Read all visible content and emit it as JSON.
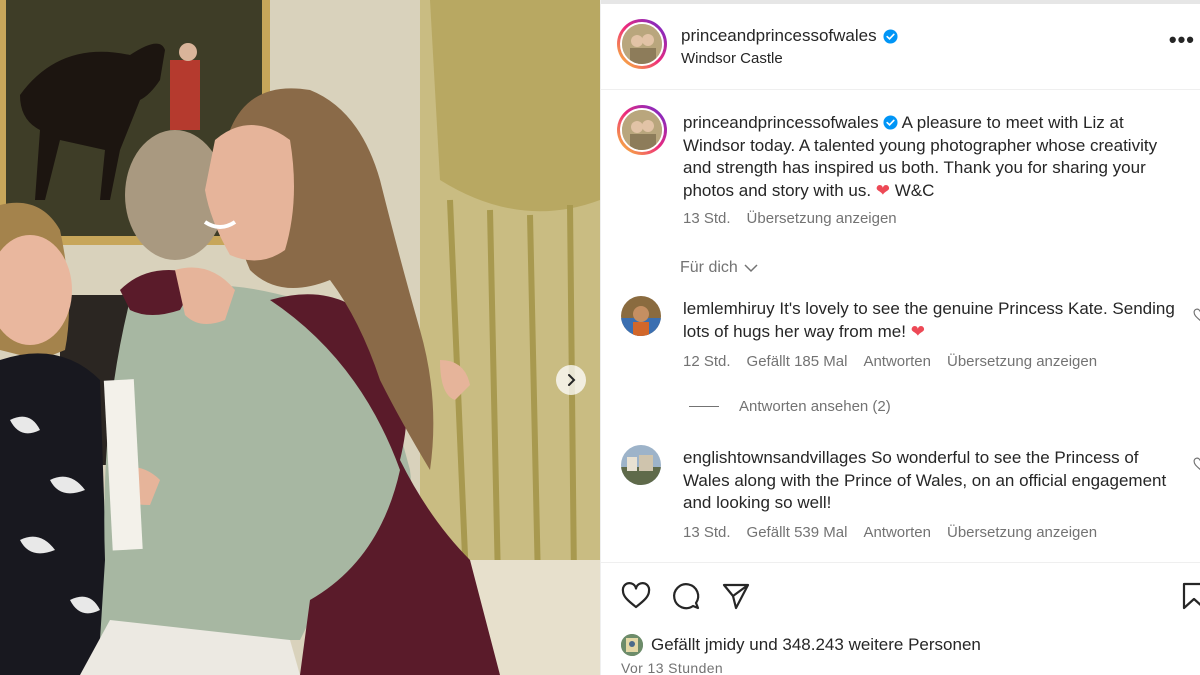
{
  "post": {
    "username": "princeandprincessofwales",
    "location": "Windsor Castle",
    "verified": true,
    "more_icon": "•••"
  },
  "caption": {
    "username": "princeandprincessofwales",
    "text": "A pleasure to meet with Liz at Windsor today. A talented young photographer whose creativity and strength has inspired us both. Thank you for sharing your photos and story with us.",
    "heart": "❤",
    "sign": "W&C",
    "time": "13 Std.",
    "translate": "Übersetzung anzeigen"
  },
  "filter": {
    "label": "Für dich"
  },
  "comments": [
    {
      "username": "lemlemhiruy",
      "text": "It's lovely to see the genuine Princess Kate. Sending lots of hugs her way from me!",
      "heart": "❤",
      "time": "12 Std.",
      "likes": "Gefällt 185 Mal",
      "reply": "Antworten",
      "translate": "Übersetzung anzeigen",
      "view_replies": "Antworten ansehen (2)"
    },
    {
      "username": "englishtownsandvillages",
      "text": "So wonderful to see the Princess of Wales along with the Prince of Wales, on an official engagement and looking so well!",
      "time": "13 Std.",
      "likes": "Gefällt 539 Mal",
      "reply": "Antworten",
      "translate": "Übersetzung anzeigen"
    }
  ],
  "likes_line": {
    "prefix": "Gefällt",
    "user": "jmidy",
    "middle": "und",
    "count": "348.243 weitere Personen"
  },
  "timestamp": "Vor 13 Stunden",
  "icons": {
    "like": "heart-outline-icon",
    "comment": "speech-bubble-icon",
    "share": "paper-plane-icon",
    "save": "bookmark-icon",
    "next": "chevron-right-icon"
  },
  "colors": {
    "verified": "#0095f6",
    "heart": "#ed4956",
    "secondary_text": "#737373"
  }
}
